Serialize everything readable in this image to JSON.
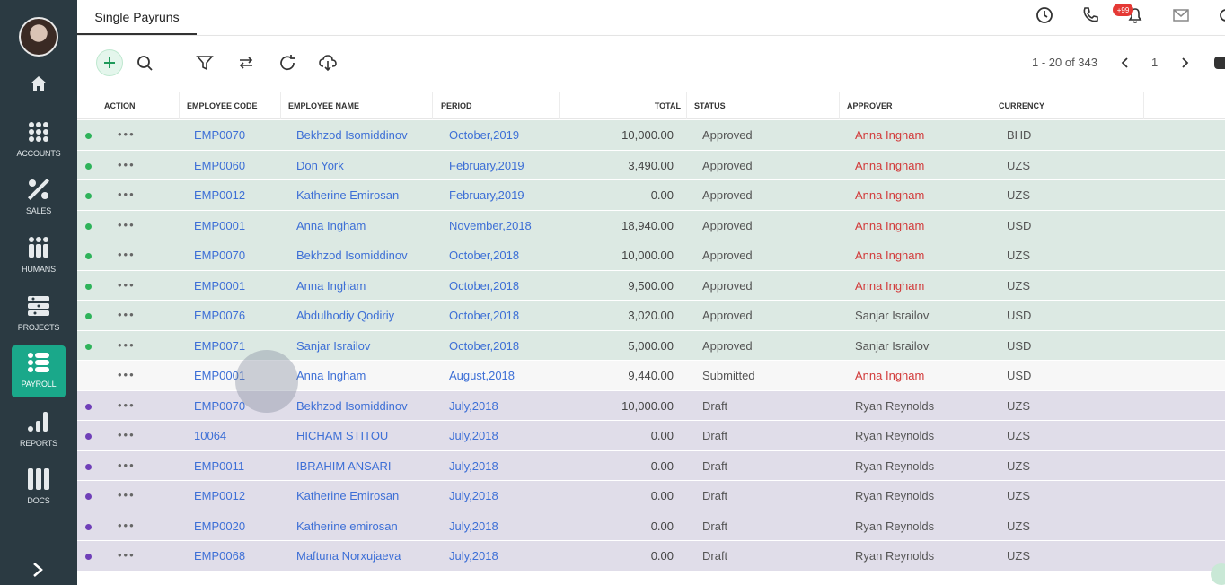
{
  "tab": {
    "label": "Single Payruns"
  },
  "notifications": {
    "badge": "+99"
  },
  "sidebar": {
    "items": [
      {
        "label": "ACCOUNTS"
      },
      {
        "label": "SALES"
      },
      {
        "label": "HUMANS"
      },
      {
        "label": "PROJECTS"
      },
      {
        "label": "PAYROLL"
      },
      {
        "label": "REPORTS"
      },
      {
        "label": "DOCS"
      }
    ]
  },
  "pager": {
    "range": "1 - 20 of 343",
    "page": "1"
  },
  "columns": {
    "action": "ACTION",
    "code": "EMPLOYEE CODE",
    "name": "EMPLOYEE NAME",
    "period": "PERIOD",
    "total": "TOTAL",
    "status": "STATUS",
    "approver": "APPROVER",
    "currency": "CURRENCY"
  },
  "rows": [
    {
      "code": "EMP0070",
      "name": "Bekhzod Isomiddinov",
      "period": "October,2019",
      "total": "10,000.00",
      "status": "Approved",
      "approver": "Anna Ingham",
      "currency": "BHD"
    },
    {
      "code": "EMP0060",
      "name": "Don York",
      "period": "February,2019",
      "total": "3,490.00",
      "status": "Approved",
      "approver": "Anna Ingham",
      "currency": "UZS"
    },
    {
      "code": "EMP0012",
      "name": "Katherine Emirosan",
      "period": "February,2019",
      "total": "0.00",
      "status": "Approved",
      "approver": "Anna Ingham",
      "currency": "UZS"
    },
    {
      "code": "EMP0001",
      "name": "Anna Ingham",
      "period": "November,2018",
      "total": "18,940.00",
      "status": "Approved",
      "approver": "Anna Ingham",
      "currency": "USD"
    },
    {
      "code": "EMP0070",
      "name": "Bekhzod Isomiddinov",
      "period": "October,2018",
      "total": "10,000.00",
      "status": "Approved",
      "approver": "Anna Ingham",
      "currency": "UZS"
    },
    {
      "code": "EMP0001",
      "name": "Anna Ingham",
      "period": "October,2018",
      "total": "9,500.00",
      "status": "Approved",
      "approver": "Anna Ingham",
      "currency": "UZS"
    },
    {
      "code": "EMP0076",
      "name": "Abdulhodiy Qodiriy",
      "period": "October,2018",
      "total": "3,020.00",
      "status": "Approved",
      "approver": "Sanjar Israilov",
      "currency": "USD"
    },
    {
      "code": "EMP0071",
      "name": "Sanjar Israilov",
      "period": "October,2018",
      "total": "5,000.00",
      "status": "Approved",
      "approver": "Sanjar Israilov",
      "currency": "USD"
    },
    {
      "code": "EMP0001",
      "name": "Anna Ingham",
      "period": "August,2018",
      "total": "9,440.00",
      "status": "Submitted",
      "approver": "Anna Ingham",
      "currency": "USD"
    },
    {
      "code": "EMP0070",
      "name": "Bekhzod Isomiddinov",
      "period": "July,2018",
      "total": "10,000.00",
      "status": "Draft",
      "approver": "Ryan Reynolds",
      "currency": "UZS"
    },
    {
      "code": "10064",
      "name": "HICHAM STITOU",
      "period": "July,2018",
      "total": "0.00",
      "status": "Draft",
      "approver": "Ryan Reynolds",
      "currency": "UZS"
    },
    {
      "code": "EMP0011",
      "name": "IBRAHIM ANSARI",
      "period": "July,2018",
      "total": "0.00",
      "status": "Draft",
      "approver": "Ryan Reynolds",
      "currency": "UZS"
    },
    {
      "code": "EMP0012",
      "name": "Katherine Emirosan",
      "period": "July,2018",
      "total": "0.00",
      "status": "Draft",
      "approver": "Ryan Reynolds",
      "currency": "UZS"
    },
    {
      "code": "EMP0020",
      "name": "Katherine emirosan",
      "period": "July,2018",
      "total": "0.00",
      "status": "Draft",
      "approver": "Ryan Reynolds",
      "currency": "UZS"
    },
    {
      "code": "EMP0068",
      "name": "Maftuna Norxujaeva",
      "period": "July,2018",
      "total": "0.00",
      "status": "Draft",
      "approver": "Ryan Reynolds",
      "currency": "UZS"
    }
  ],
  "colors": {
    "approved_dot": "#2eb35a",
    "draft_dot": "#6f3fb8",
    "approver_red": "#d23b3b",
    "accent": "#1aa88a"
  }
}
